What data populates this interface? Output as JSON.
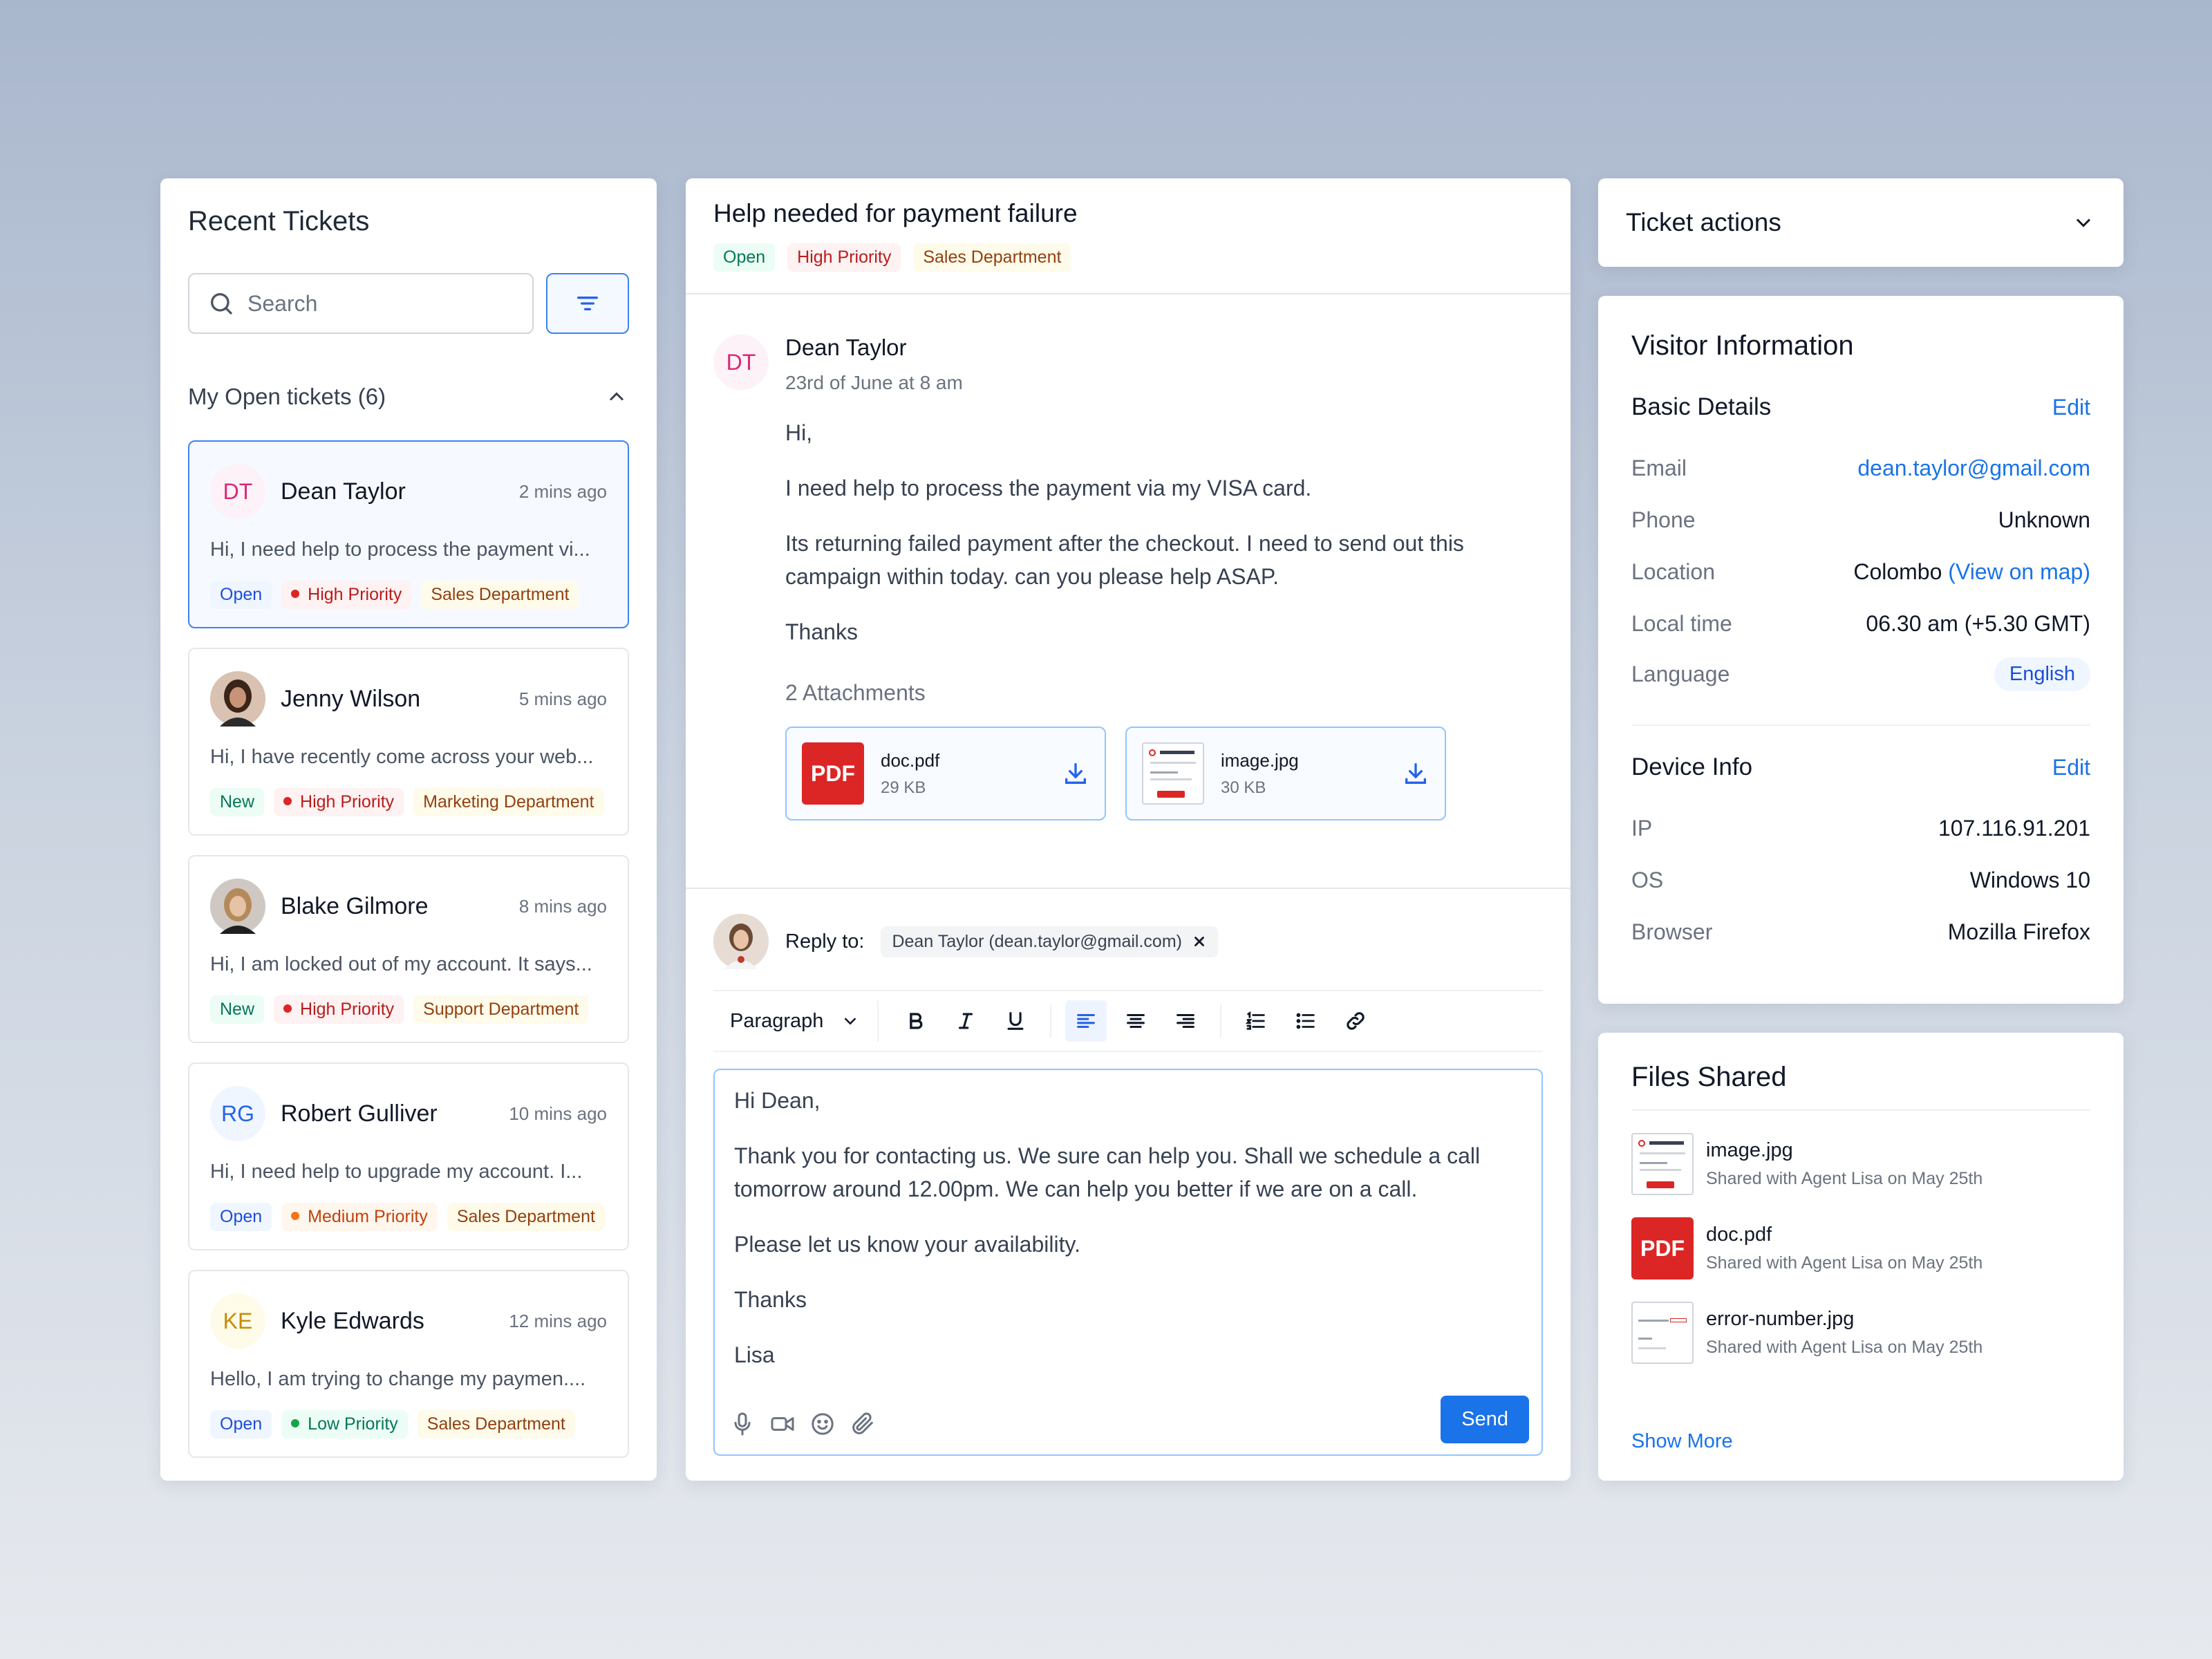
{
  "tickets_panel": {
    "title": "Recent Tickets",
    "search_placeholder": "Search",
    "section_label": "My Open tickets (6)",
    "tickets": [
      {
        "initials": "DT",
        "name": "Dean Taylor",
        "time": "2 mins ago",
        "message": "Hi, I need help to process the payment vi...",
        "status": "Open",
        "priority": "High Priority",
        "department": "Sales Department"
      },
      {
        "initials": "",
        "name": "Jenny Wilson",
        "time": "5 mins ago",
        "message": "Hi, I have recently come across your web...",
        "status": "New",
        "priority": "High Priority",
        "department": "Marketing Department"
      },
      {
        "initials": "",
        "name": "Blake Gilmore",
        "time": "8 mins ago",
        "message": "Hi, I am locked out of my account. It says...",
        "status": "New",
        "priority": "High Priority",
        "department": "Support Department"
      },
      {
        "initials": "RG",
        "name": "Robert Gulliver",
        "time": "10 mins ago",
        "message": "Hi, I need help to upgrade my account. I...",
        "status": "Open",
        "priority": "Medium Priority",
        "department": "Sales Department"
      },
      {
        "initials": "KE",
        "name": "Kyle Edwards",
        "time": "12 mins ago",
        "message": "Hello, I am trying to change my paymen....",
        "status": "Open",
        "priority": "Low Priority",
        "department": "Sales Department"
      }
    ]
  },
  "conversation": {
    "title": "Help needed for payment failure",
    "tags": {
      "status": "Open",
      "priority": "High Priority",
      "department": "Sales Department"
    },
    "message": {
      "initials": "DT",
      "author": "Dean Taylor",
      "date": "23rd of June at 8 am",
      "paragraphs": [
        "Hi,",
        "I need help to process the payment via my VISA card.",
        "Its returning failed payment after the checkout. I need to send out this campaign within today. can you please help ASAP.",
        "Thanks"
      ]
    },
    "attachments_title": "2 Attachments",
    "attachments": [
      {
        "name": "doc.pdf",
        "size": "29 KB",
        "badge": "PDF"
      },
      {
        "name": "image.jpg",
        "size": "30 KB"
      }
    ],
    "reply": {
      "label": "Reply to:",
      "recipient": "Dean Taylor (dean.taylor@gmail.com)",
      "format": "Paragraph",
      "body": [
        "Hi Dean,",
        "Thank you for contacting us. We sure can help you. Shall we schedule a call tomorrow around 12.00pm. We can help you better if we are on a call.",
        "Please let us know your availability.",
        "Thanks",
        "Lisa"
      ],
      "send_label": "Send"
    }
  },
  "actions": {
    "label": "Ticket actions"
  },
  "visitor": {
    "title": "Visitor Information",
    "basic_title": "Basic Details",
    "edit_label": "Edit",
    "email_label": "Email",
    "email": "dean.taylor@gmail.com",
    "phone_label": "Phone",
    "phone": "Unknown",
    "location_label": "Location",
    "location": "Colombo",
    "map_link": "(View on map)",
    "time_label": "Local time",
    "time": "06.30 am (+5.30 GMT)",
    "language_label": "Language",
    "language": "English",
    "device_title": "Device Info",
    "ip_label": "IP",
    "ip": "107.116.91.201",
    "os_label": "OS",
    "os": "Windows 10",
    "browser_label": "Browser",
    "browser": "Mozilla Firefox"
  },
  "files": {
    "title": "Files Shared",
    "items": [
      {
        "name": "image.jpg",
        "meta": "Shared with Agent Lisa on May 25th"
      },
      {
        "name": "doc.pdf",
        "meta": "Shared with Agent Lisa on May 25th",
        "badge": "PDF"
      },
      {
        "name": "error-number.jpg",
        "meta": "Shared with Agent Lisa on May 25th"
      }
    ],
    "show_more": "Show More"
  },
  "colors": {
    "accent": "#1a73e8",
    "high": "#dc2626",
    "medium": "#f97316",
    "low": "#16a34a"
  }
}
